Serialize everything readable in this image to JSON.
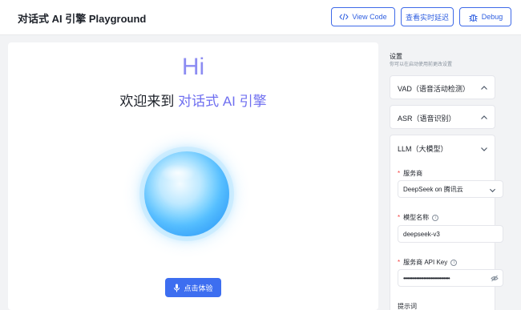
{
  "header": {
    "title": "对话式 AI 引擎 Playground",
    "view_code_label": "View Code",
    "latency_label": "查看实时延迟",
    "debug_label": "Debug",
    "accent_color": "#3f6ae8"
  },
  "main": {
    "greeting": "Hi",
    "welcome_prefix": "欢迎来到 ",
    "welcome_brand": "对话式 AI 引擎",
    "start_button_label": "点击体验"
  },
  "settings": {
    "title": "设置",
    "subtitle": "你可以在启动使用前更改设置",
    "sections": {
      "vad": {
        "label": "VAD（语音活动检测）",
        "expanded": false
      },
      "asr": {
        "label": "ASR（语音识别）",
        "expanded": false
      },
      "llm": {
        "label": "LLM（大模型）",
        "expanded": true
      }
    },
    "llm_fields": {
      "provider_label": "服务商",
      "provider_value": "DeepSeek on 腾讯云",
      "model_label": "模型名称",
      "model_value": "deepseek-v3",
      "api_key_label": "服务商 API Key",
      "api_key_masked": "••••••••••••••••••••••••••••••••",
      "prompt_label": "提示词"
    },
    "required_marker": "*",
    "info_symbol": "i"
  },
  "icons": {
    "code": "code-icon",
    "bug": "bug-icon",
    "mic": "microphone-icon",
    "chevron_up": "chevron-up-icon",
    "chevron_down": "chevron-down-icon",
    "eye_off": "eye-off-icon",
    "info": "info-icon"
  }
}
